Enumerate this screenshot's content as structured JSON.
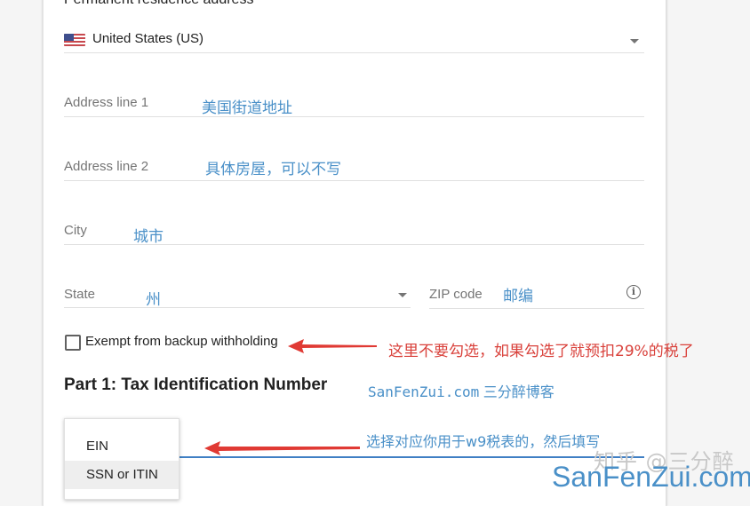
{
  "form": {
    "section_label": "Permanent residence address",
    "country": {
      "flag_icon": "us-flag-icon",
      "value": "United States (US)"
    },
    "address_line_1": {
      "label": "Address line 1",
      "value": "美国街道地址"
    },
    "address_line_2": {
      "label": "Address line 2",
      "value": "具体房屋，可以不写"
    },
    "city": {
      "label": "City",
      "value": "城市"
    },
    "state": {
      "label": "State",
      "value": "州"
    },
    "zip": {
      "label": "ZIP code",
      "value": "邮编"
    },
    "exempt_checkbox": {
      "label": "Exempt from backup withholding",
      "checked": false
    },
    "part1_title": "Part 1: Tax Identification Number",
    "tin_menu": {
      "options": [
        "EIN",
        "SSN or ITIN"
      ],
      "highlighted": "SSN or ITIN"
    }
  },
  "annotations": {
    "checkbox_note": "这里不要勾选，如果勾选了就预扣29%的税了",
    "site_note_en": "SanFenZui.com",
    "site_note_cn": "三分醉博客",
    "tin_note": "选择对应你用于w9税表的，然后填写"
  },
  "watermarks": {
    "zhihu": "知乎 @三分醉",
    "site": "SanFenZui.com"
  },
  "colors": {
    "accent_blue": "#3f7fc4",
    "annotation_red": "#d9413b",
    "annotation_blue": "#4a90c8"
  }
}
